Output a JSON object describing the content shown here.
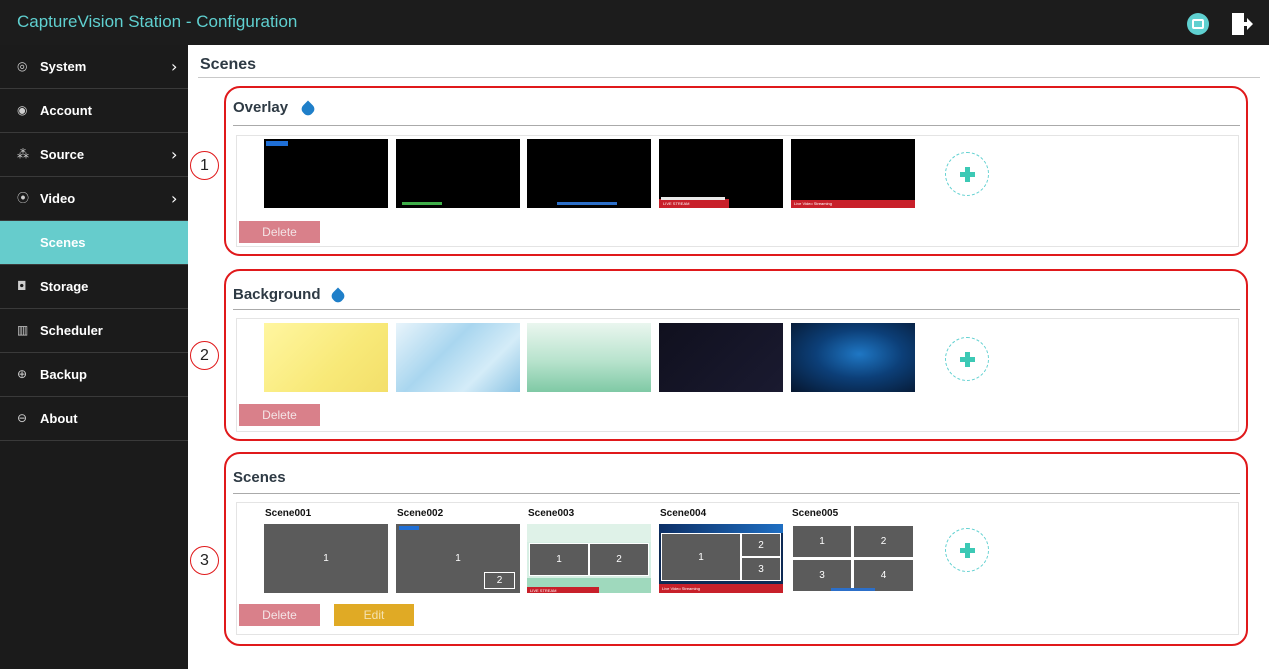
{
  "app": {
    "title": "CaptureVision Station - Configuration",
    "icons": [
      "preview-icon",
      "logout-icon"
    ]
  },
  "sidebar": {
    "items": [
      {
        "label": "System",
        "icon": "circle-target-icon",
        "has_submenu": true
      },
      {
        "label": "Account",
        "icon": "user-circle-icon",
        "has_submenu": false
      },
      {
        "label": "Source",
        "icon": "hierarchy-icon",
        "has_submenu": true
      },
      {
        "label": "Video",
        "icon": "radio-dot-icon",
        "has_submenu": true
      },
      {
        "label": "Scenes",
        "icon": "",
        "has_submenu": false,
        "active": true
      },
      {
        "label": "Storage",
        "icon": "storage-icon",
        "has_submenu": false
      },
      {
        "label": "Scheduler",
        "icon": "scheduler-icon",
        "has_submenu": false
      },
      {
        "label": "Backup",
        "icon": "cloud-upload-icon",
        "has_submenu": false
      },
      {
        "label": "About",
        "icon": "info-circle-icon",
        "has_submenu": false
      }
    ],
    "active_color": "#66cccc"
  },
  "main": {
    "page_title": "Scenes",
    "sections": [
      {
        "title": "Overlay",
        "callout": "1",
        "delete_label": "Delete",
        "thumbnails": [
          {
            "kind": "overlay",
            "tag_text": "",
            "strip_color": "#1f6fd6"
          },
          {
            "kind": "overlay",
            "tag_text": "",
            "strip_color": "#3fae49"
          },
          {
            "kind": "overlay",
            "tag_text": "",
            "strip_color": "#2c6fc9"
          },
          {
            "kind": "overlay",
            "tag_text": "LIVE STREAM",
            "strip_color": "#c8202a"
          },
          {
            "kind": "overlay",
            "tag_text": "Live Video Streaming",
            "strip_color": "#c8202a"
          }
        ]
      },
      {
        "title": "Background",
        "callout": "2",
        "delete_label": "Delete",
        "thumbnails": [
          {
            "kind": "background",
            "color": "#fbee8a"
          },
          {
            "kind": "background",
            "color": "#bfe0f2"
          },
          {
            "kind": "background",
            "color": "#a8dcc4"
          },
          {
            "kind": "background",
            "color": "#161629"
          },
          {
            "kind": "background",
            "color": "#0a3a6a"
          }
        ]
      },
      {
        "title": "Scenes",
        "callout": "3",
        "delete_label": "Delete",
        "edit_label": "Edit",
        "scenes": [
          {
            "name": "Scene001",
            "cells": [
              "1"
            ]
          },
          {
            "name": "Scene002",
            "cells": [
              "1",
              "2"
            ]
          },
          {
            "name": "Scene003",
            "cells": [
              "1",
              "2"
            ],
            "strip_text": "LIVE STREAM"
          },
          {
            "name": "Scene004",
            "cells": [
              "1",
              "2",
              "3"
            ],
            "strip_text": "Live Video Streaming"
          },
          {
            "name": "Scene005",
            "cells": [
              "1",
              "2",
              "3",
              "4"
            ]
          }
        ]
      }
    ]
  },
  "colors": {
    "accent": "#5fd0d0",
    "callout_red": "#e0191b",
    "delete_button": "#d9808a",
    "edit_button": "#e0aa25",
    "tag_blue": "#1f7fc9"
  }
}
